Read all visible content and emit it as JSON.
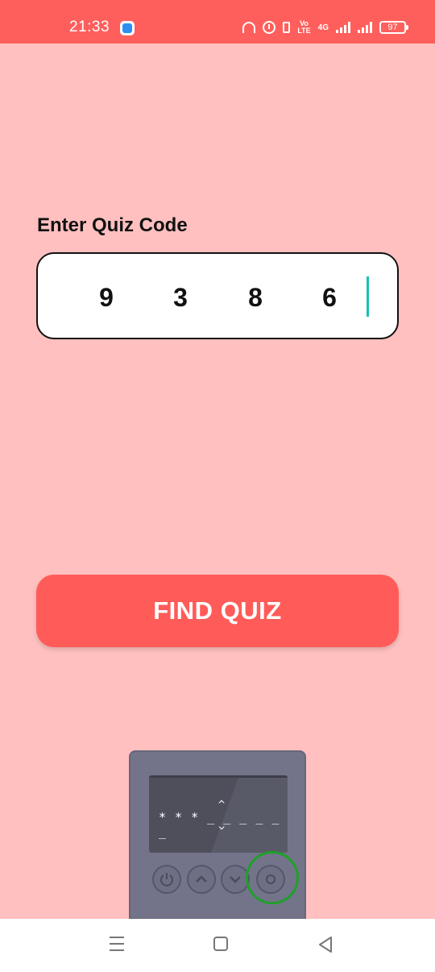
{
  "status_bar": {
    "time": "21:33",
    "volte_top": "Vo",
    "volte_bottom": "LTE",
    "network": "4G",
    "battery": "97"
  },
  "quiz": {
    "label": "Enter Quiz Code",
    "digits": [
      "9",
      "3",
      "8",
      "6"
    ],
    "button_label": "FIND QUIZ"
  },
  "device": {
    "screen_text": "* * * _ _ _ _ _ _",
    "caret_up": "^",
    "caret_down": "^"
  },
  "icons": {
    "buttons": [
      "power-icon",
      "chevron-up-icon",
      "chevron-down-icon",
      "circle-icon"
    ]
  },
  "colors": {
    "background": "#ffc0bf",
    "accent": "#ff5c59",
    "cursor": "#15c2b4",
    "highlight": "#1fa02a"
  }
}
